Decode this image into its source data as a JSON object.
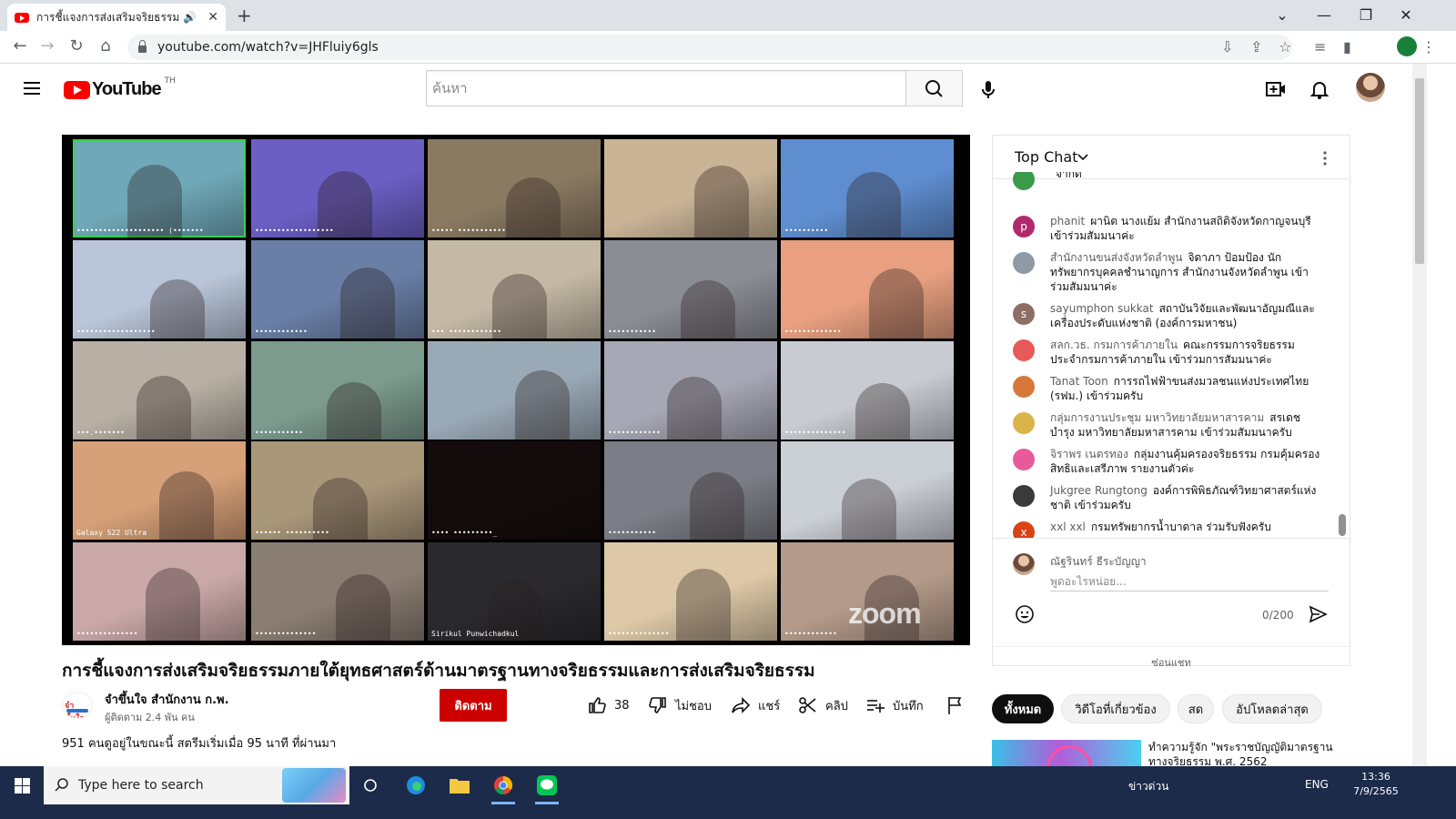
{
  "browser": {
    "tab_title": "การชี้แจงการส่งเสริมจริยธรรมภายใ",
    "url": "youtube.com/watch?v=JHFluiy6gls"
  },
  "header": {
    "logo_text": "YouTube",
    "country": "TH",
    "search_placeholder": "ค้นหา"
  },
  "player": {
    "tiles": [
      {
        "label": "•••••••••••••••••••• (•••••••",
        "color": "#6fa8b8",
        "active": true
      },
      {
        "label": "••••••••••••••••••",
        "color": "#6b5fc4"
      },
      {
        "label": "••••• •••••••••••",
        "color": "#8a7a62"
      },
      {
        "label": "",
        "color": "#c9b496"
      },
      {
        "label": "••••••••••",
        "color": "#5f8ed0"
      },
      {
        "label": "••••••••••••••••••",
        "color": "#b9c5d8"
      },
      {
        "label": "••••••••••••",
        "color": "#6a7fa6"
      },
      {
        "label": "••• ••••••••••••",
        "color": "#c4b9a5"
      },
      {
        "label": "•••••••••••",
        "color": "#8b8d95"
      },
      {
        "label": "•••••••••••••",
        "color": "#e8a080"
      },
      {
        "label": "•••.•••••••",
        "color": "#b8b0a4"
      },
      {
        "label": "•••••••••••",
        "color": "#7c9a8e"
      },
      {
        "label": "",
        "color": "#9aa9b6"
      },
      {
        "label": "••••••••••••",
        "color": "#a7a8b5"
      },
      {
        "label": "••••••••••••••",
        "color": "#c8ccd2"
      },
      {
        "label": "Galaxy S22 Ultra",
        "color": "#d6a078"
      },
      {
        "label": "•••••• ••••••••••",
        "color": "#a9977a"
      },
      {
        "label": "•••• •••••••••_",
        "color": "#140c0c"
      },
      {
        "label": "•••••••••••",
        "color": "#7b7e86"
      },
      {
        "label": "",
        "color": "#cbcfd6"
      },
      {
        "label": "••••••••••••••",
        "color": "#caa8a8"
      },
      {
        "label": "••••••••••••••",
        "color": "#8a7d72"
      },
      {
        "label": "Sirikul Punwichadkul",
        "color": "#2a2a2e"
      },
      {
        "label": "••••••••••••••",
        "color": "#ddc9a7"
      },
      {
        "label": "••••••••••••",
        "color": "#b39a8a"
      }
    ],
    "watermark": "zoom"
  },
  "video": {
    "title": "การชี้แจงการส่งเสริมจริยธรรมภายใต้ยุทธศาสตร์ด้านมาตรฐานทางจริยธรรมและการส่งเสริมจริยธรรม",
    "channel_name": "จำขึ้นใจ สำนักงาน ก.พ.",
    "subscribers": "ผู้ติดตาม 2.4 พัน คน",
    "subscribe_label": "ติดตาม",
    "likes": "38",
    "dislike_label": "ไม่ชอบ",
    "share_label": "แชร์",
    "clip_label": "คลิป",
    "save_label": "บันทึก",
    "stats": "951 คนดูอยู่ในขณะนี้  สตรีมเริ่มเมื่อ 95 นาที ที่ผ่านมา"
  },
  "chat": {
    "title": "Top Chat",
    "messages": [
      {
        "author": "",
        "text": "จำกัด",
        "avatar": "",
        "color": "#3a9a4a"
      },
      {
        "author": "phanit",
        "text": "ผานิต นางแย้ม สำนักงานสถิติจังหวัดกาญจนบุรี เข้าร่วมสัมมนาค่ะ",
        "avatar": "p",
        "color": "#b02a6b"
      },
      {
        "author": "สำนักงานขนส่งจังหวัดลำพูน",
        "text": "จิดาภา ป้อมป้อง นักทรัพยากรบุคคลชำนาญการ สำนักงานจังหวัดลำพูน เข้าร่วมสัมมนาค่ะ",
        "avatar": "",
        "color": "#8e9aa6"
      },
      {
        "author": "sayumphon sukkat",
        "text": "สถาบันวิจัยและพัฒนาอัญมณีและเครื่องประดับแห่งชาติ (องค์การมหาชน)",
        "avatar": "s",
        "color": "#8d6e63"
      },
      {
        "author": "สลก.วธ. กรมการค้าภายใน",
        "text": "คณะกรรมการจริยธรรมประจำกรมการค้าภายใน เข้าร่วมการสัมมนาค่ะ",
        "avatar": "",
        "color": "#e85a5a"
      },
      {
        "author": "Tanat Toon",
        "text": "การรถไฟฟ้าขนส่งมวลชนแห่งประเทศไทย (รฟม.) เข้าร่วมครับ",
        "avatar": "",
        "color": "#d7783a"
      },
      {
        "author": "กลุ่มการงานประชุม มหาวิทยาลัยมหาสารคาม",
        "text": "สรเดช บำรุง มหาวิทยาลัยมหาสารคาม เข้าร่วมสัมมนาครับ",
        "avatar": "",
        "color": "#d9b44a"
      },
      {
        "author": "จิราพร เนตรทอง",
        "text": "กลุ่มงานคุ้มครองจริยธรรม กรมคุ้มครองสิทธิและเสรีภาพ รายงานตัวค่ะ",
        "avatar": "",
        "color": "#e85a9a"
      },
      {
        "author": "Jukgree Rungtong",
        "text": "องค์การพิพิธภัณฑ์วิทยาศาสตร์แห่งชาติ เข้าร่วมครับ",
        "avatar": "",
        "color": "#3a3a3a"
      },
      {
        "author": "xxl xxl",
        "text": "กรมทรัพยากรน้ำบาดาล ร่วมรับฟังครับ",
        "avatar": "x",
        "color": "#d84315"
      }
    ],
    "self_name": "ณัฐรินทร์ ธีระบัญญา",
    "input_placeholder": "พูดอะไรหน่อย...",
    "counter": "0/200",
    "hide_label": "ซ่อนแชท"
  },
  "chips": [
    "ทั้งหมด",
    "วิดีโอที่เกี่ยวข้อง",
    "สด",
    "อัปโหลดล่าสุด"
  ],
  "related": {
    "title": "ทำความรู้จัก \"พระราชบัญญัติมาตรฐานทางจริยธรรม พ.ศ. 2562"
  },
  "taskbar": {
    "search_placeholder": "Type here to search",
    "news": "ข่าวด่วน",
    "lang": "ENG",
    "time": "13:36",
    "date": "7/9/2565",
    "notifications": "2"
  }
}
